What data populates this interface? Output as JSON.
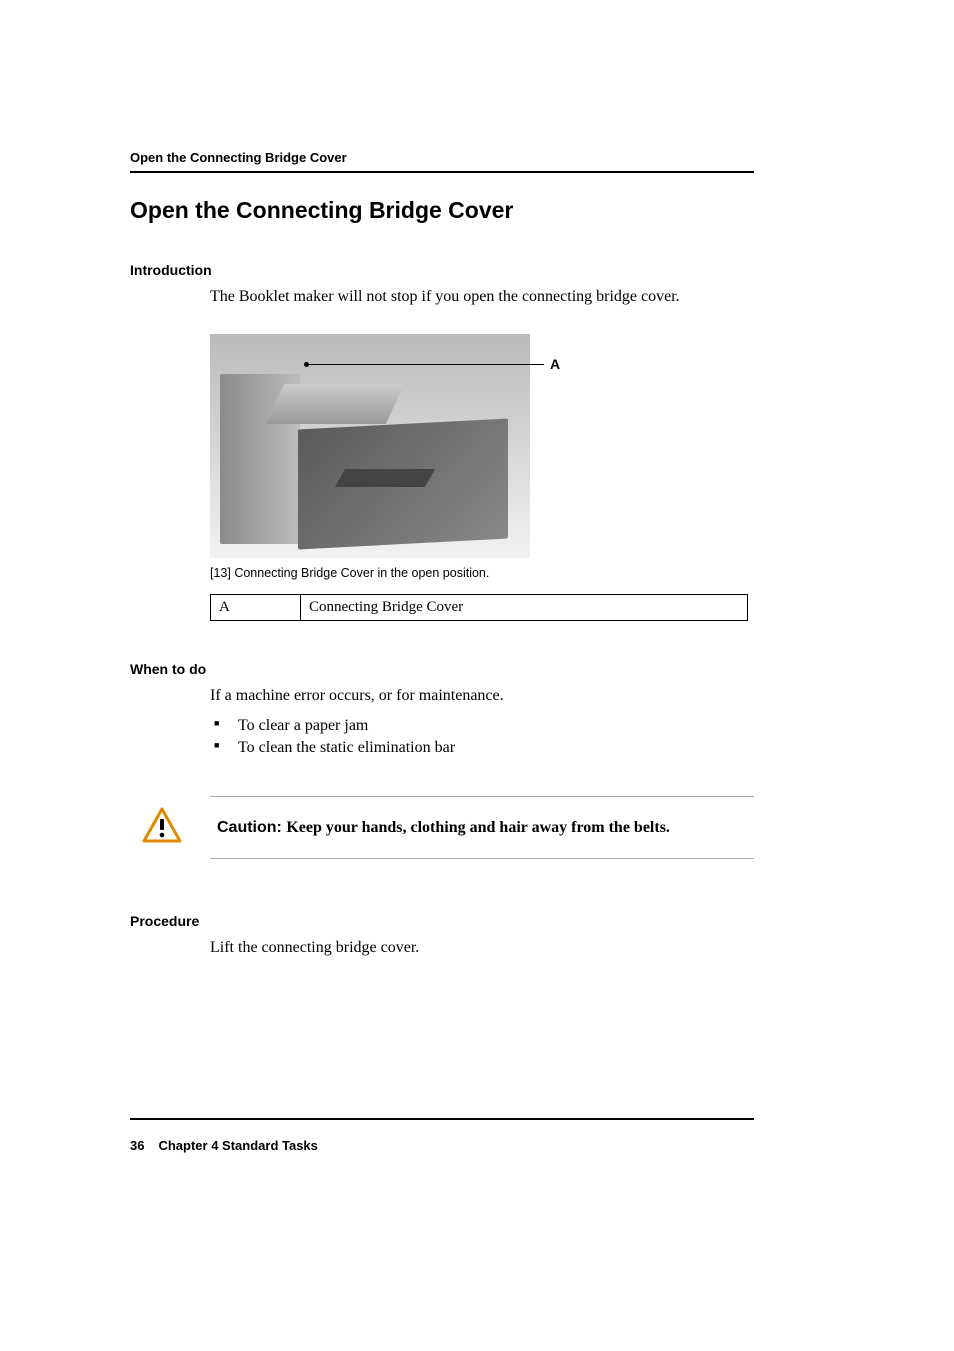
{
  "runningHeader": "Open the Connecting Bridge Cover",
  "mainHeading": "Open the Connecting Bridge Cover",
  "sections": {
    "introduction": {
      "heading": "Introduction",
      "body": "The Booklet maker will not stop if you open the connecting bridge cover."
    },
    "figure": {
      "calloutLabel": "A",
      "caption": "[13] Connecting Bridge Cover in the open position.",
      "legend": {
        "key": "A",
        "value": "Connecting Bridge Cover"
      }
    },
    "whenToDo": {
      "heading": "When to do",
      "body": "If a machine error occurs, or for maintenance.",
      "bullets": [
        "To clear a paper jam",
        "To clean the static elimination bar"
      ]
    },
    "caution": {
      "label": "Caution: ",
      "message": "Keep your hands, clothing and hair away from the belts."
    },
    "procedure": {
      "heading": "Procedure",
      "body": "Lift the connecting bridge cover."
    }
  },
  "footer": {
    "pageNumber": "36",
    "chapter": "Chapter 4 Standard Tasks"
  }
}
